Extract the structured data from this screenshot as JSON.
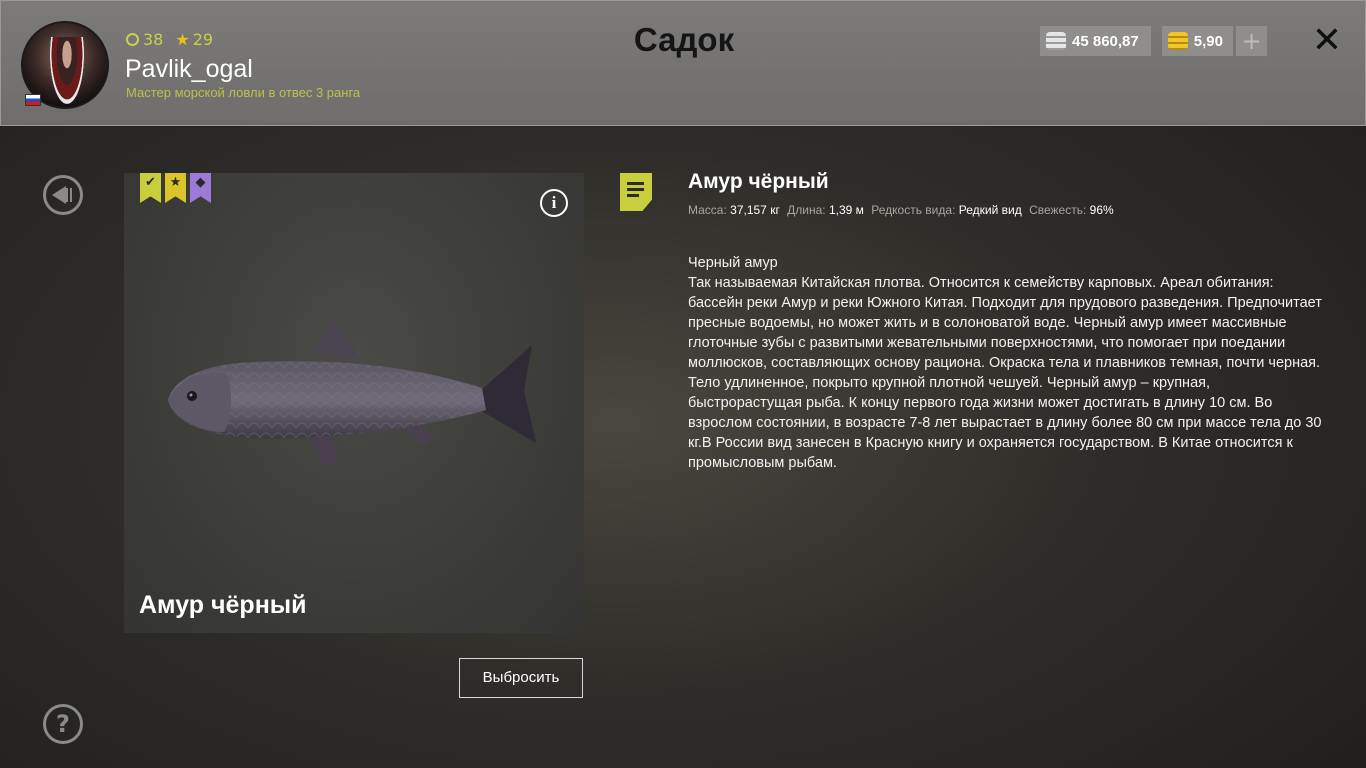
{
  "header": {
    "title": "Садок",
    "player": {
      "level": "38",
      "stars": "29",
      "username": "Pavlik_ogal",
      "rank": "Мастер морской ловли в отвес 3 ранга"
    },
    "currency": {
      "silver": "45 860,87",
      "gold": "5,90"
    },
    "plus_label": "+",
    "close_label": "✕"
  },
  "fish": {
    "card_name": "Амур чёрный",
    "title": "Амур чёрный",
    "stats": {
      "mass_label": "Масса:",
      "mass_value": "37,157 кг",
      "length_label": "Длина:",
      "length_value": "1,39 м",
      "rarity_label": "Редкость вида:",
      "rarity_value": "Редкий вид",
      "freshness_label": "Свежесть:",
      "freshness_value": "96%"
    },
    "description_title": "Черный амур",
    "description": "Так называемая Китайская плотва. Относится к семейству карповых. Ареал обитания: бассейн реки Амур и реки Южного Китая. Подходит для прудового разведения. Предпочитает пресные водоемы, но может жить и в солоноватой воде. Черный амур имеет массивные глоточные зубы с развитыми жевательными поверхностями, что помогает при поедании моллюсков, составляющих основу рациона. Окраска тела и плавников темная, почти черная. Тело удлиненное, покрыто крупной плотной чешуей. Черный амур – крупная, быстрорастущая рыба. К концу первого года жизни может достигать в длину 10 см. Во взрослом состоянии, в возрасте 7-8 лет вырастает в длину более 80 см при массе тела до 30 кг.В России вид занесен в Красную книгу и охраняется государством. В Китае относится к промысловым рыбам."
  },
  "actions": {
    "discard_label": "Выбросить",
    "help_label": "?"
  },
  "colors": {
    "accent_green": "#c9cf3c",
    "rank_text": "#b9c24a",
    "badge_purple": "#9c7ad8"
  },
  "icons": [
    "back-icon",
    "help-icon",
    "info-icon",
    "close-icon",
    "silver-coin-icon",
    "gold-coin-icon",
    "document-icon",
    "check-badge-icon",
    "star-badge-icon",
    "diamond-badge-icon"
  ]
}
